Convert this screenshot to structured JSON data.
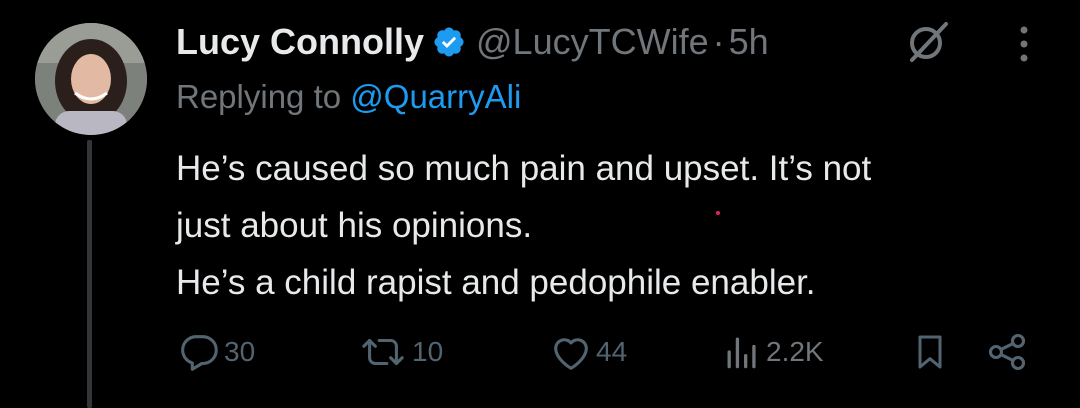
{
  "tweet": {
    "author_name": "Lucy Connolly",
    "handle": "@LucyTCWife",
    "separator": "·",
    "time": "5h",
    "replying_prefix": "Replying to",
    "replying_to": "@QuarryAli",
    "lines": [
      "He’s caused so much pain and upset. It’s not",
      "just about his opinions.",
      "He’s a child rapist and pedophile enabler."
    ],
    "verified_icon": "verified-badge-icon",
    "colors": {
      "background": "#000000",
      "text": "#e7e9ea",
      "muted": "#71767b",
      "accent": "#1d9bf0"
    }
  },
  "actions": {
    "replies": "30",
    "reposts": "10",
    "likes": "44",
    "views": "2.2K"
  }
}
